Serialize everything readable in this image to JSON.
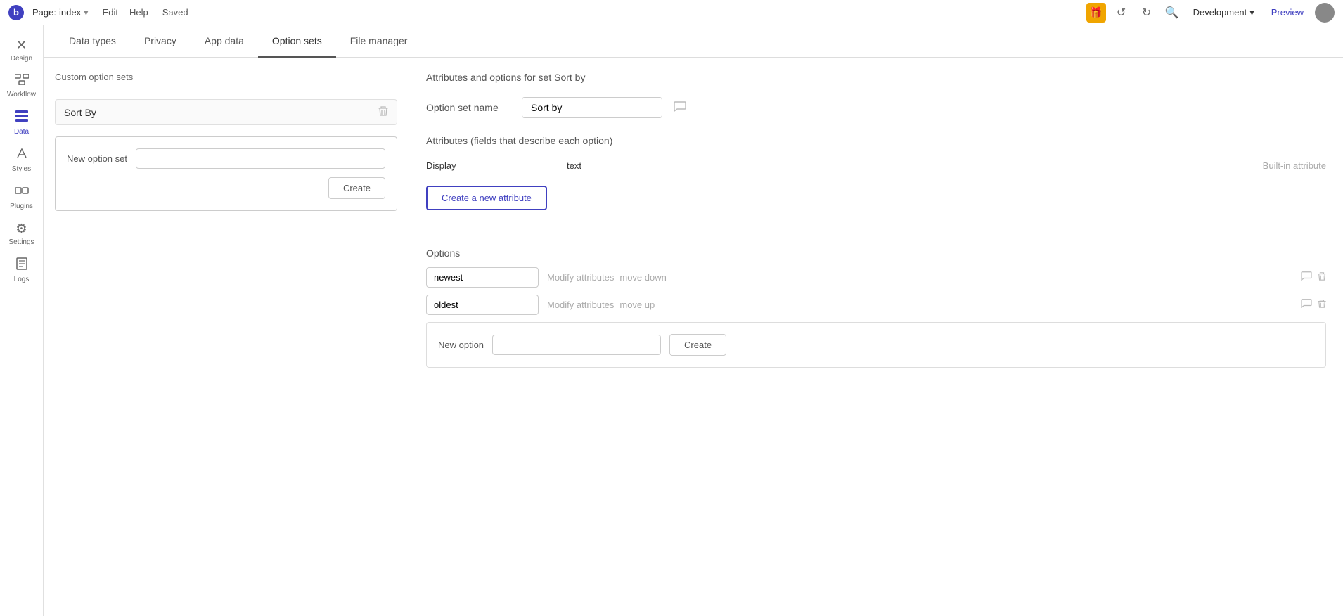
{
  "topbar": {
    "logo": "b",
    "page_label": "Page:",
    "page_name": "index",
    "dropdown_icon": "▾",
    "edit_label": "Edit",
    "help_label": "Help",
    "saved_label": "Saved",
    "gift_icon": "🎁",
    "undo_icon": "↺",
    "redo_icon": "↻",
    "search_icon": "🔍",
    "env_label": "Development",
    "env_icon": "▾",
    "preview_label": "Preview"
  },
  "sidebar": {
    "items": [
      {
        "id": "design",
        "label": "Design",
        "icon": "✕"
      },
      {
        "id": "workflow",
        "label": "Workflow",
        "icon": "⬡⬡"
      },
      {
        "id": "data",
        "label": "Data",
        "icon": "≡"
      },
      {
        "id": "styles",
        "label": "Styles",
        "icon": "✏"
      },
      {
        "id": "plugins",
        "label": "Plugins",
        "icon": "⬛⬛"
      },
      {
        "id": "settings",
        "label": "Settings",
        "icon": "⚙"
      },
      {
        "id": "logs",
        "label": "Logs",
        "icon": "📄"
      }
    ],
    "active": "data"
  },
  "tabs": [
    {
      "id": "data-types",
      "label": "Data types"
    },
    {
      "id": "privacy",
      "label": "Privacy"
    },
    {
      "id": "app-data",
      "label": "App data"
    },
    {
      "id": "option-sets",
      "label": "Option sets"
    },
    {
      "id": "file-manager",
      "label": "File manager"
    }
  ],
  "active_tab": "option-sets",
  "left_panel": {
    "title": "Custom option sets",
    "option_set": {
      "name": "Sort By"
    },
    "new_option_set": {
      "label": "New option set",
      "input_value": "",
      "create_btn": "Create"
    }
  },
  "right_panel": {
    "title": "Attributes and options for set Sort by",
    "option_set_name_label": "Option set name",
    "option_set_name_value": "Sort by",
    "attributes_section_label": "Attributes (fields that describe each option)",
    "attributes": [
      {
        "col1": "Display",
        "col2": "text",
        "col3": "Built-in attribute"
      }
    ],
    "create_attribute_btn": "Create a new attribute",
    "options_section_label": "Options",
    "options": [
      {
        "value": "newest",
        "action1": "Modify attributes",
        "action2": "move down"
      },
      {
        "value": "oldest",
        "action1": "Modify attributes",
        "action2": "move up"
      }
    ],
    "new_option": {
      "label": "New option",
      "input_value": "",
      "create_btn": "Create"
    }
  }
}
